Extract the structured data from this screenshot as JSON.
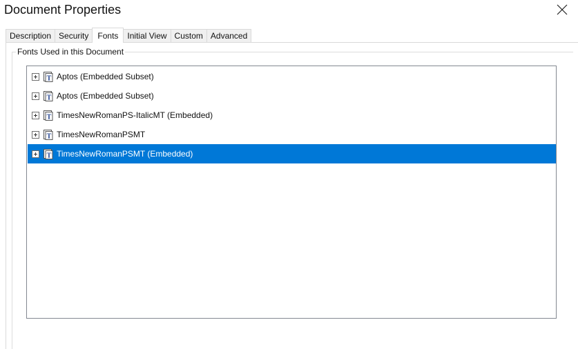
{
  "window": {
    "title": "Document Properties"
  },
  "tabs": [
    {
      "label": "Description",
      "active": false
    },
    {
      "label": "Security",
      "active": false
    },
    {
      "label": "Fonts",
      "active": true
    },
    {
      "label": "Initial View",
      "active": false
    },
    {
      "label": "Custom",
      "active": false
    },
    {
      "label": "Advanced",
      "active": false
    }
  ],
  "fonts_group": {
    "label": "Fonts Used in this Document",
    "items": [
      {
        "label": "Aptos (Embedded Subset)",
        "icon": "truetype-font-icon",
        "selected": false
      },
      {
        "label": "Aptos (Embedded Subset)",
        "icon": "truetype-font-icon",
        "selected": false
      },
      {
        "label": "TimesNewRomanPS-ItalicMT (Embedded)",
        "icon": "truetype-font-icon",
        "selected": false
      },
      {
        "label": "TimesNewRomanPSMT",
        "icon": "truetype-font-icon",
        "selected": false
      },
      {
        "label": "TimesNewRomanPSMT (Embedded)",
        "icon": "truetype-font-icon",
        "selected": true
      }
    ]
  },
  "colors": {
    "selection": "#0078d7"
  }
}
